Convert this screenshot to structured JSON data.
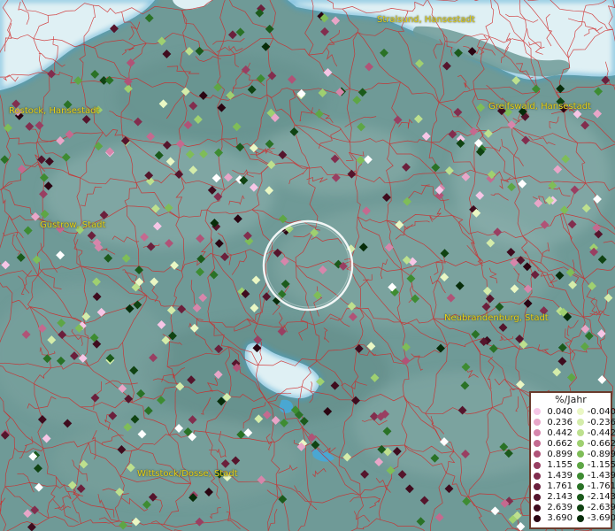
{
  "map": {
    "cities": [
      {
        "name": "Stralsund, Hansestadt"
      },
      {
        "name": "Rostock, Hansestadt"
      },
      {
        "name": "Greifswald, Hansestadt"
      },
      {
        "name": "Güstrow, Stadt"
      },
      {
        "name": "Neubrandenburg, Stadt"
      },
      {
        "name": "Wittstock/Dosse, Stadt"
      }
    ]
  },
  "legend": {
    "title": "%/Jahr",
    "rows": [
      {
        "pos": "0.040",
        "neg": "-0.040",
        "pos_color": "#f6c6e6",
        "neg_color": "#eaf7c4"
      },
      {
        "pos": "0.236",
        "neg": "-0.236",
        "pos_color": "#e8a6c8",
        "neg_color": "#d4ecaa"
      },
      {
        "pos": "0.442",
        "neg": "-0.442",
        "pos_color": "#d686ab",
        "neg_color": "#bde08e"
      },
      {
        "pos": "0.662",
        "neg": "-0.662",
        "pos_color": "#c46a8f",
        "neg_color": "#9fd070"
      },
      {
        "pos": "0.899",
        "neg": "-0.899",
        "pos_color": "#b05377",
        "neg_color": "#7fbd58"
      },
      {
        "pos": "1.155",
        "neg": "-1.155",
        "pos_color": "#993f62",
        "neg_color": "#5ea645"
      },
      {
        "pos": "1.439",
        "neg": "-1.439",
        "pos_color": "#822e4e",
        "neg_color": "#3e8c32"
      },
      {
        "pos": "1.761",
        "neg": "-1.761",
        "pos_color": "#6b203c",
        "neg_color": "#2a7226"
      },
      {
        "pos": "2.143",
        "neg": "-2.143",
        "pos_color": "#55152c",
        "neg_color": "#1b5a1b"
      },
      {
        "pos": "2.639",
        "neg": "-2.639",
        "pos_color": "#3f0c1e",
        "neg_color": "#104312"
      },
      {
        "pos": "3.690",
        "neg": "-3.690",
        "pos_color": "#2a0512",
        "neg_color": "#072d0a"
      }
    ]
  }
}
